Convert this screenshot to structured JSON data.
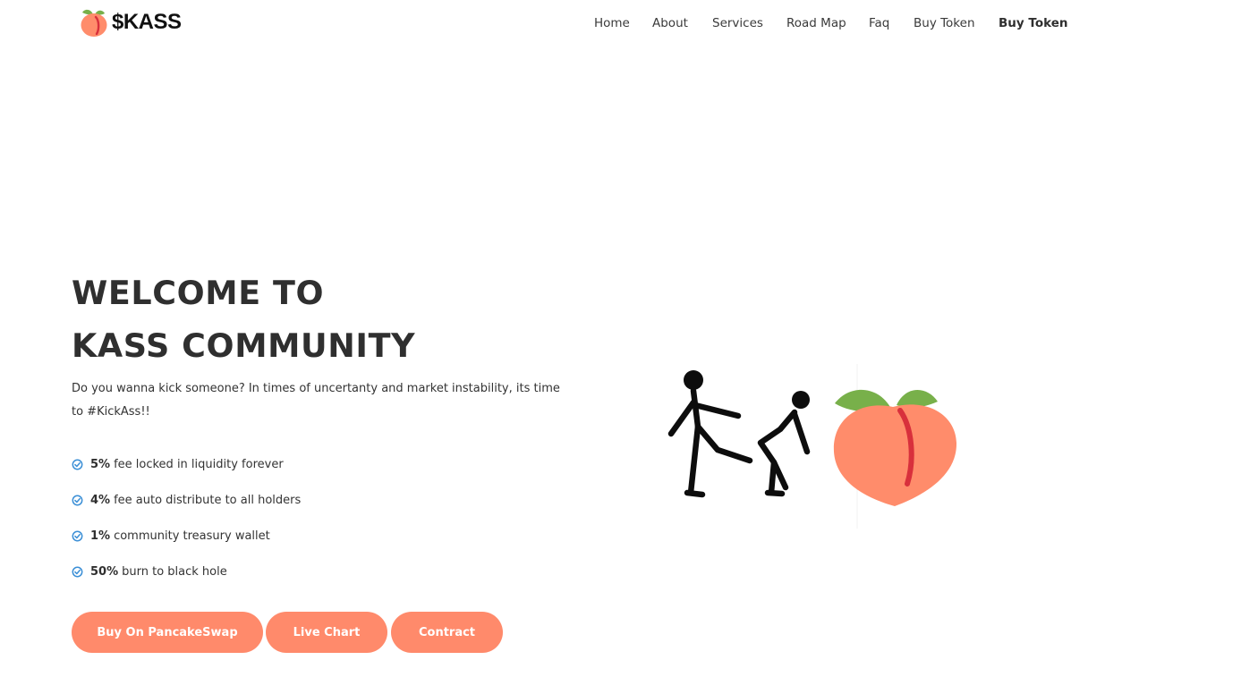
{
  "brand": {
    "name": "$KASS",
    "logo_icon": "peach-icon"
  },
  "nav": {
    "items": [
      "Home",
      "About",
      "Services",
      "Road Map",
      "Faq",
      "Buy Token"
    ],
    "cta": "Buy Token"
  },
  "hero": {
    "title_line1": "WELCOME TO",
    "title_line2": "KASS COMMUNITY",
    "description": "Do you wanna kick someone? In times of uncertanty and market instability, its time to #KickAss!!",
    "features": [
      {
        "strong": "5%",
        "text": "fee locked in liquidity forever"
      },
      {
        "strong": "4%",
        "text": "fee auto distribute to all holders"
      },
      {
        "strong": "1%",
        "text": "community treasury wallet"
      },
      {
        "strong": "50%",
        "text": "burn to black hole"
      }
    ],
    "buttons": {
      "pancakeswap": "Buy On PancakeSwap",
      "live_chart": "Live Chart",
      "contract": "Contract"
    },
    "illustration_icons": [
      "kicking-figures-icon",
      "peach-icon"
    ]
  },
  "colors": {
    "accent": "#ff8a6b",
    "check": "#3b8fd6",
    "peach": "#ff8c6b",
    "leaf": "#78b04a",
    "crease": "#d8303c",
    "text": "#2f2f2f"
  }
}
